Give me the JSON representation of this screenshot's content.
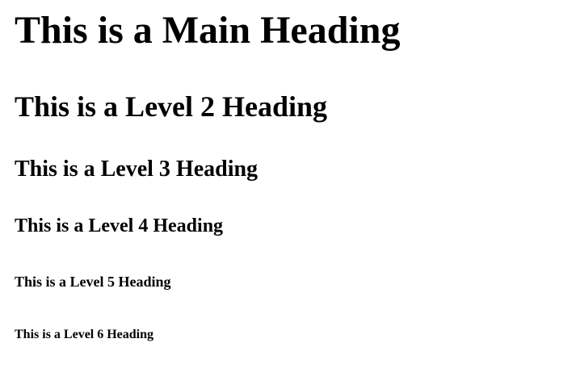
{
  "headings": {
    "h1": "This is a Main Heading",
    "h2": "This is a Level 2 Heading",
    "h3": "This is a Level 3 Heading",
    "h4": "This is a Level 4 Heading",
    "h5": "This is a Level 5 Heading",
    "h6": "This is a Level 6 Heading"
  }
}
